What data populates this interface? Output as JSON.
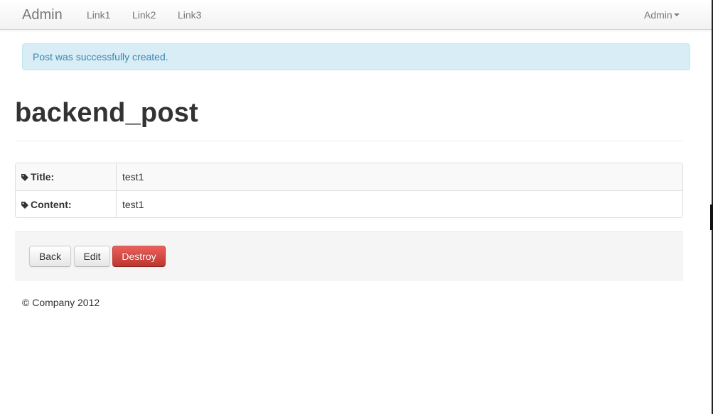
{
  "navbar": {
    "brand": "Admin",
    "links": [
      "Link1",
      "Link2",
      "Link3"
    ],
    "user_menu": "Admin"
  },
  "alert": {
    "message": "Post was successfully created."
  },
  "page": {
    "title": "backend_post"
  },
  "details": {
    "rows": [
      {
        "label": "Title:",
        "value": "test1"
      },
      {
        "label": "Content:",
        "value": "test1"
      }
    ]
  },
  "actions": {
    "back_label": "Back",
    "edit_label": "Edit",
    "destroy_label": "Destroy"
  },
  "footer": {
    "text": "© Company 2012"
  },
  "colors": {
    "alert_bg": "#d9edf7",
    "alert_text": "#3a87ad",
    "danger": "#da4f49"
  }
}
